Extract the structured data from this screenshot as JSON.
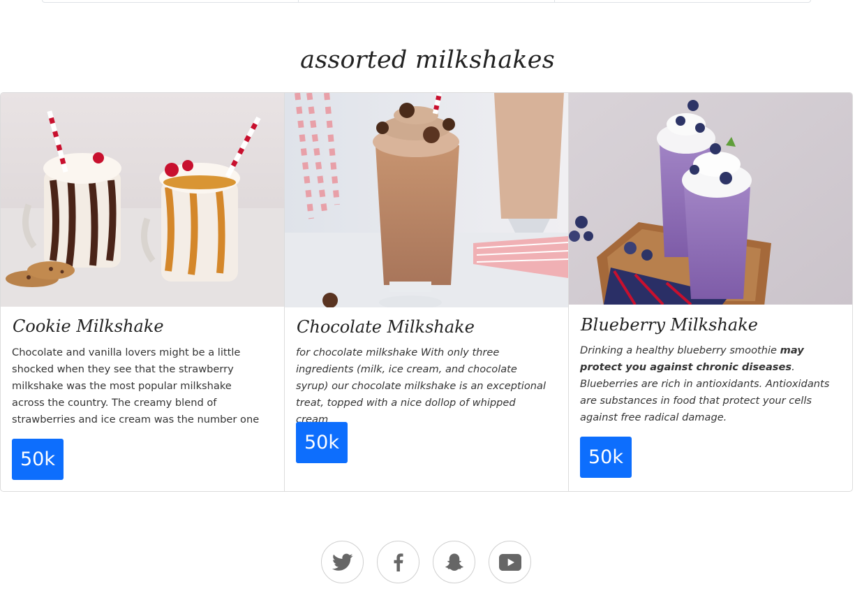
{
  "section": {
    "title": "assorted milkshakes"
  },
  "cards": [
    {
      "title": "Cookie Milkshake",
      "text": " Chocolate and vanilla lovers might be a little shocked when they see that the strawberry milkshake was the most popular milkshake across the country. The creamy blend of strawberries and ice cream was the number one milkshake in",
      "price": "50k",
      "image": "cookie-milkshake-photo"
    },
    {
      "title": "Chocolate Milkshake",
      "text": "for chocolate milkshake With only three ingredients (milk, ice cream, and chocolate syrup) our chocolate milkshake is an exceptional treat, topped with a nice dollop of whipped cream",
      "price": "50k",
      "image": "chocolate-milkshake-photo"
    },
    {
      "title": "Blueberry Milkshake",
      "text_before": "Drinking a healthy blueberry smoothie ",
      "text_bold": "may protect you against chronic diseases",
      "text_after": ". Blueberries are rich in antioxidants. Antioxidants are substances in food that protect your cells against free radical damage.",
      "price": "50k",
      "image": "blueberry-milkshake-photo"
    }
  ],
  "social": [
    {
      "icon": "twitter-icon"
    },
    {
      "icon": "facebook-icon"
    },
    {
      "icon": "snapchat-icon"
    },
    {
      "icon": "youtube-icon"
    }
  ],
  "colors": {
    "accent": "#0d6efd",
    "icon_gray": "#666666"
  }
}
